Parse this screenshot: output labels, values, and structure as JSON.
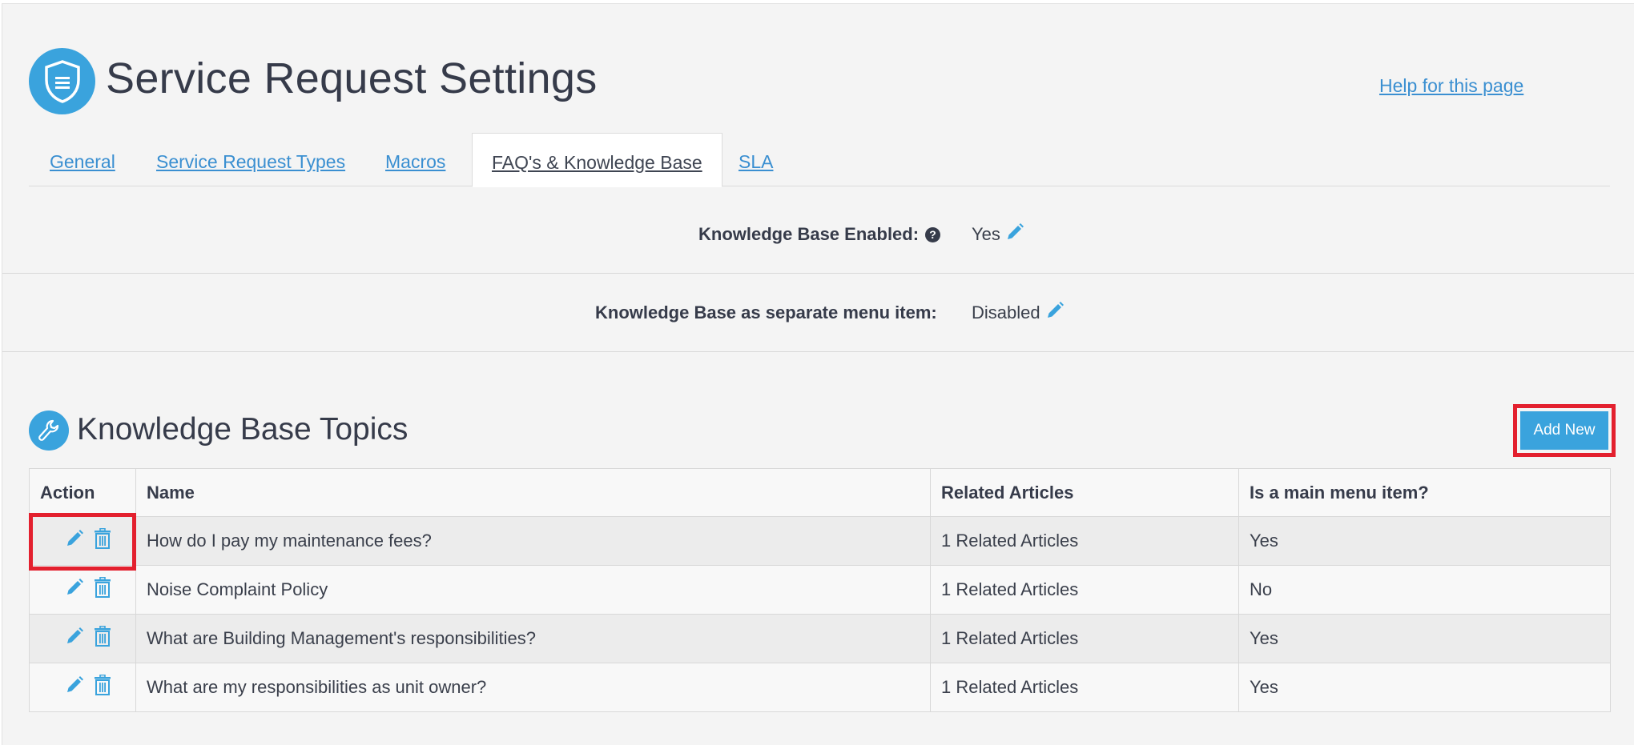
{
  "header": {
    "title": "Service Request Settings",
    "help_link": "Help for this page",
    "icon": "shield-document-icon"
  },
  "tabs": [
    {
      "label": "General",
      "active": false
    },
    {
      "label": "Service Request Types",
      "active": false
    },
    {
      "label": "Macros",
      "active": false
    },
    {
      "label": "FAQ's & Knowledge Base",
      "active": true
    },
    {
      "label": "SLA",
      "active": false
    }
  ],
  "settings": {
    "kb_enabled": {
      "label": "Knowledge Base Enabled:",
      "value": "Yes"
    },
    "kb_separate_menu": {
      "label": "Knowledge Base as separate menu item:",
      "value": "Disabled"
    }
  },
  "topics": {
    "title": "Knowledge Base Topics",
    "icon": "wrench-icon",
    "add_new_label": "Add New",
    "columns": [
      "Action",
      "Name",
      "Related Articles",
      "Is a main menu item?"
    ],
    "rows": [
      {
        "name": "How do I pay my maintenance fees?",
        "related": "1 Related Articles",
        "main_menu": "Yes"
      },
      {
        "name": "Noise Complaint Policy",
        "related": "1 Related Articles",
        "main_menu": "No"
      },
      {
        "name": "What are Building Management's responsibilities?",
        "related": "1 Related Articles",
        "main_menu": "Yes"
      },
      {
        "name": "What are my responsibilities as unit owner?",
        "related": "1 Related Articles",
        "main_menu": "Yes"
      }
    ]
  },
  "colors": {
    "accent": "#3aa3dd",
    "link": "#3a8fd1",
    "highlight": "#e3202e",
    "background": "#f4f4f4"
  }
}
